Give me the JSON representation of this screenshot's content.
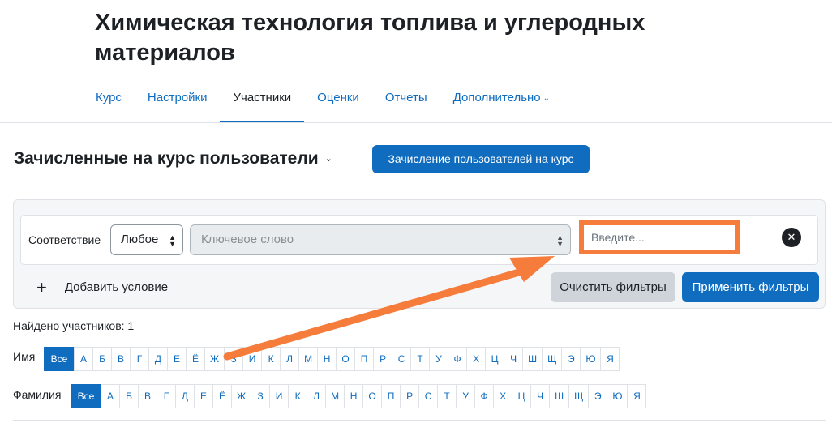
{
  "course": {
    "title": "Химическая технология топлива и углеродных материалов"
  },
  "nav": {
    "tabs": [
      {
        "label": "Курс"
      },
      {
        "label": "Настройки"
      },
      {
        "label": "Участники"
      },
      {
        "label": "Оценки"
      },
      {
        "label": "Отчеты"
      },
      {
        "label": "Дополнительно"
      }
    ],
    "active_tab": "Участники"
  },
  "page": {
    "heading": "Зачисленные на курс пользователи",
    "enrol_button": "Зачисление пользователей на курс"
  },
  "filter": {
    "match_label": "Соответствие",
    "match_value": "Любое",
    "condition_type": "Ключевое слово",
    "value_placeholder": "Введите...",
    "remove_label": "✕",
    "add_condition": "Добавить условие",
    "clear_button": "Очистить фильтры",
    "apply_button": "Применить фильтры"
  },
  "results": {
    "found_text": "Найдено участников: 1"
  },
  "initials": {
    "first_name_label": "Имя",
    "last_name_label": "Фамилия",
    "all_label": "Все",
    "letters": [
      "А",
      "Б",
      "В",
      "Г",
      "Д",
      "Е",
      "Ё",
      "Ж",
      "З",
      "И",
      "К",
      "Л",
      "М",
      "Н",
      "О",
      "П",
      "Р",
      "С",
      "Т",
      "У",
      "Ф",
      "Х",
      "Ц",
      "Ч",
      "Ш",
      "Щ",
      "Э",
      "Ю",
      "Я"
    ]
  },
  "annotation": {
    "arrow_color": "#f57c3b",
    "highlight_color": "#f57c3b"
  },
  "colors": {
    "primary": "#0f6cbf",
    "secondary_button": "#ced4da"
  }
}
